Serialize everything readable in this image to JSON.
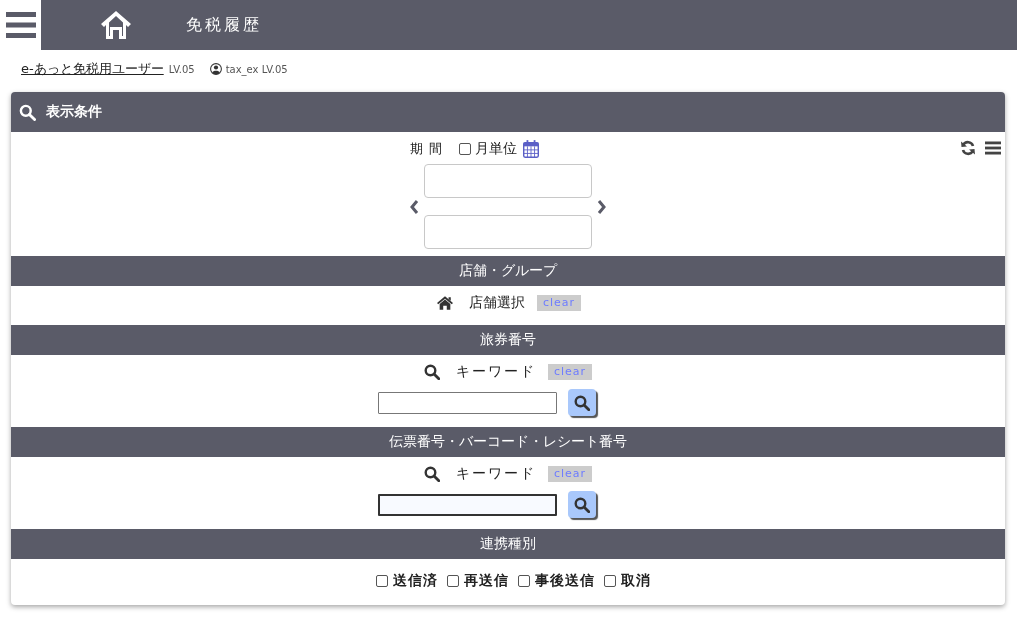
{
  "header": {
    "title": "免税履歴"
  },
  "user": {
    "name": "e-あっと免税用ユーザー",
    "level": "LV.05",
    "account": "tax_ex LV.05"
  },
  "panel": {
    "title": "表示条件",
    "period": {
      "label": "期 間",
      "monthly": {
        "label": "月単位",
        "checked": false
      }
    },
    "sections": [
      {
        "kind": "store",
        "title": "店舗・グループ",
        "label": "店舗選択",
        "clear": "clear"
      },
      {
        "kind": "keyword",
        "title": "旅券番号",
        "label": "キーワード",
        "clear": "clear",
        "focused": false
      },
      {
        "kind": "keyword",
        "title": "伝票番号・バーコード・レシート番号",
        "label": "キーワード",
        "clear": "clear",
        "focused": true
      },
      {
        "kind": "checks",
        "title": "連携種別",
        "options": [
          {
            "label": "送信済",
            "checked": false
          },
          {
            "label": "再送信",
            "checked": false
          },
          {
            "label": "事後送信",
            "checked": false
          },
          {
            "label": "取消",
            "checked": false
          }
        ]
      }
    ]
  }
}
